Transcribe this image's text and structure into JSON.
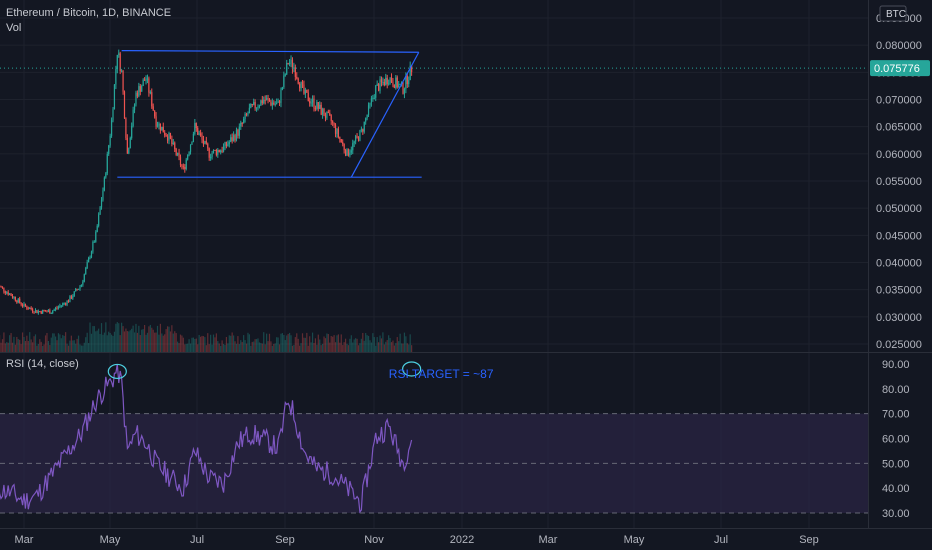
{
  "header": {
    "symbol_line": "Ethereum / Bitcoin, 1D, BINANCE",
    "volume_label": "Vol",
    "currency_badge": "BTC"
  },
  "rsi_panel": {
    "label": "RSI (14, close)",
    "annotation": "RSI TARGET = ~87"
  },
  "colors": {
    "background": "#131722",
    "grid": "#1e222d",
    "up": "#26a69a",
    "down": "#ef5350",
    "trendline": "#2962ff",
    "rsi_line": "#7e57c2",
    "rsi_band": "#2a2443",
    "price_tag": "#26a69a",
    "annotation": "#2962ff",
    "circle": "#4dd0e1"
  },
  "chart_data": [
    {
      "type": "candlestick",
      "title": "Ethereum / Bitcoin, 1D, BINANCE",
      "currency": "BTC",
      "x_ticks": [
        "Mar",
        "May",
        "Jul",
        "Sep",
        "Nov",
        "2022",
        "Mar",
        "May",
        "Jul",
        "Sep"
      ],
      "y_ticks": [
        "0.025000",
        "0.030000",
        "0.035000",
        "0.040000",
        "0.045000",
        "0.050000",
        "0.055000",
        "0.060000",
        "0.065000",
        "0.070000",
        "0.075000",
        "0.080000",
        "0.085000"
      ],
      "ylim": [
        0.0235,
        0.0865
      ],
      "last_price": 0.075776,
      "last_price_label": "0.075776",
      "series": [
        {
          "name": "close",
          "x": [
            "2021-02-10",
            "2021-02-20",
            "2021-03-01",
            "2021-03-10",
            "2021-03-20",
            "2021-04-01",
            "2021-04-10",
            "2021-04-20",
            "2021-04-26",
            "2021-05-01",
            "2021-05-05",
            "2021-05-08",
            "2021-05-12",
            "2021-05-18",
            "2021-05-25",
            "2021-06-01",
            "2021-06-10",
            "2021-06-20",
            "2021-06-28",
            "2021-07-08",
            "2021-07-18",
            "2021-07-28",
            "2021-08-05",
            "2021-08-15",
            "2021-08-25",
            "2021-09-01",
            "2021-09-05",
            "2021-09-12",
            "2021-09-20",
            "2021-10-01",
            "2021-10-12",
            "2021-10-22",
            "2021-11-01",
            "2021-11-10",
            "2021-11-20",
            "2021-11-26"
          ],
          "y": [
            0.036,
            0.034,
            0.032,
            0.031,
            0.031,
            0.033,
            0.036,
            0.045,
            0.055,
            0.066,
            0.079,
            0.075,
            0.06,
            0.071,
            0.074,
            0.066,
            0.063,
            0.057,
            0.065,
            0.06,
            0.061,
            0.064,
            0.068,
            0.07,
            0.069,
            0.077,
            0.076,
            0.071,
            0.069,
            0.066,
            0.06,
            0.064,
            0.072,
            0.074,
            0.072,
            0.075776
          ]
        }
      ],
      "annotations": [
        {
          "type": "trendline",
          "from": [
            "2021-05-08",
            0.079
          ],
          "to": [
            "2021-12-01",
            0.0787
          ]
        },
        {
          "type": "trendline",
          "from": [
            "2021-05-05",
            0.0557
          ],
          "to": [
            "2021-12-03",
            0.0557
          ]
        },
        {
          "type": "trendline",
          "from": [
            "2021-10-15",
            0.0557
          ],
          "to": [
            "2021-12-01",
            0.0787
          ]
        }
      ]
    },
    {
      "type": "line",
      "title": "RSI (14, close)",
      "y_ticks": [
        "30.00",
        "40.00",
        "50.00",
        "60.00",
        "70.00",
        "80.00",
        "90.00"
      ],
      "ylim": [
        25,
        95
      ],
      "band": [
        30,
        70
      ],
      "midline": 50,
      "series": [
        {
          "name": "RSI (14, close)",
          "x": [
            "2021-02-10",
            "2021-02-20",
            "2021-03-01",
            "2021-03-10",
            "2021-03-20",
            "2021-04-01",
            "2021-04-10",
            "2021-04-20",
            "2021-04-26",
            "2021-05-01",
            "2021-05-05",
            "2021-05-08",
            "2021-05-12",
            "2021-05-18",
            "2021-05-25",
            "2021-06-01",
            "2021-06-10",
            "2021-06-20",
            "2021-06-28",
            "2021-07-08",
            "2021-07-18",
            "2021-07-28",
            "2021-08-05",
            "2021-08-15",
            "2021-08-25",
            "2021-09-01",
            "2021-09-05",
            "2021-09-12",
            "2021-09-20",
            "2021-10-01",
            "2021-10-12",
            "2021-10-22",
            "2021-11-01",
            "2021-11-10",
            "2021-11-20",
            "2021-11-26"
          ],
          "y": [
            40,
            38,
            35,
            37,
            45,
            55,
            62,
            75,
            80,
            83,
            88,
            82,
            55,
            62,
            58,
            50,
            45,
            40,
            55,
            44,
            42,
            58,
            62,
            60,
            56,
            76,
            70,
            55,
            48,
            46,
            40,
            34,
            60,
            65,
            50,
            60
          ]
        }
      ],
      "annotations": [
        {
          "type": "circle",
          "at": [
            "2021-05-05",
            87
          ]
        },
        {
          "type": "circle",
          "at": [
            "2021-11-26",
            88
          ]
        },
        {
          "type": "text",
          "text": "RSI TARGET = ~87",
          "at": [
            "2021-12-01",
            86
          ]
        }
      ]
    }
  ]
}
